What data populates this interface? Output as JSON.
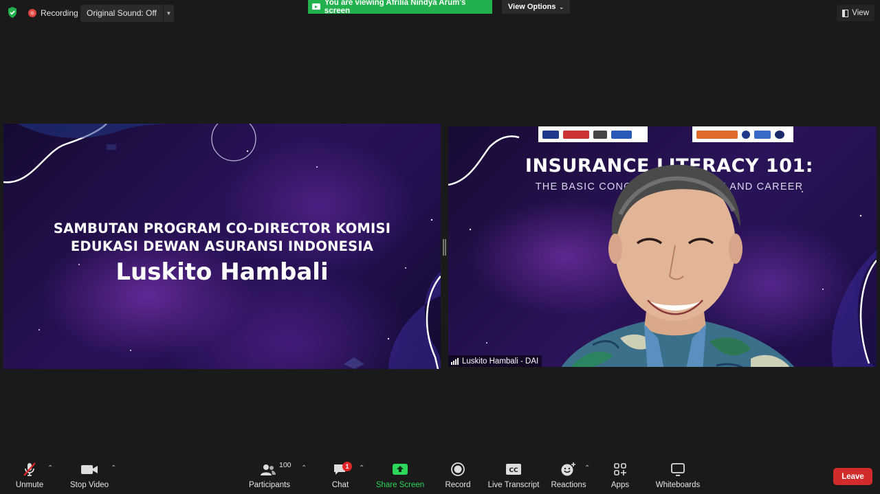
{
  "top_bar": {
    "recording_label": "Recording",
    "original_sound_label": "Original Sound: Off",
    "viewing_banner": "You are viewing Afrilia Nindya Arum's screen",
    "view_options_label": "View Options",
    "view_label": "View"
  },
  "shared_slide": {
    "line1": "SAMBUTAN PROGRAM CO-DIRECTOR KOMISI",
    "line2": "EDUKASI DEWAN ASURANSI INDONESIA",
    "speaker_name": "Luskito Hambali"
  },
  "video_tile": {
    "background_title": "INSURANCE LITERACY 101:",
    "background_subtitle": "THE BASIC CONCE                    CE AND CAREER",
    "participant_name": "Luskito Hambali - DAI"
  },
  "toolbar": {
    "unmute_label": "Unmute",
    "stop_video_label": "Stop Video",
    "participants_label": "Participants",
    "participants_count": "100",
    "chat_label": "Chat",
    "chat_badge": "1",
    "share_screen_label": "Share Screen",
    "record_label": "Record",
    "live_transcript_label": "Live Transcript",
    "reactions_label": "Reactions",
    "apps_label": "Apps",
    "whiteboards_label": "Whiteboards",
    "leave_label": "Leave"
  },
  "colors": {
    "background": "#1a1a1a",
    "viewing_banner": "#22b14c",
    "share_screen": "#2bd65a",
    "leave": "#d12b2b",
    "recording_dot": "#e0443e"
  }
}
